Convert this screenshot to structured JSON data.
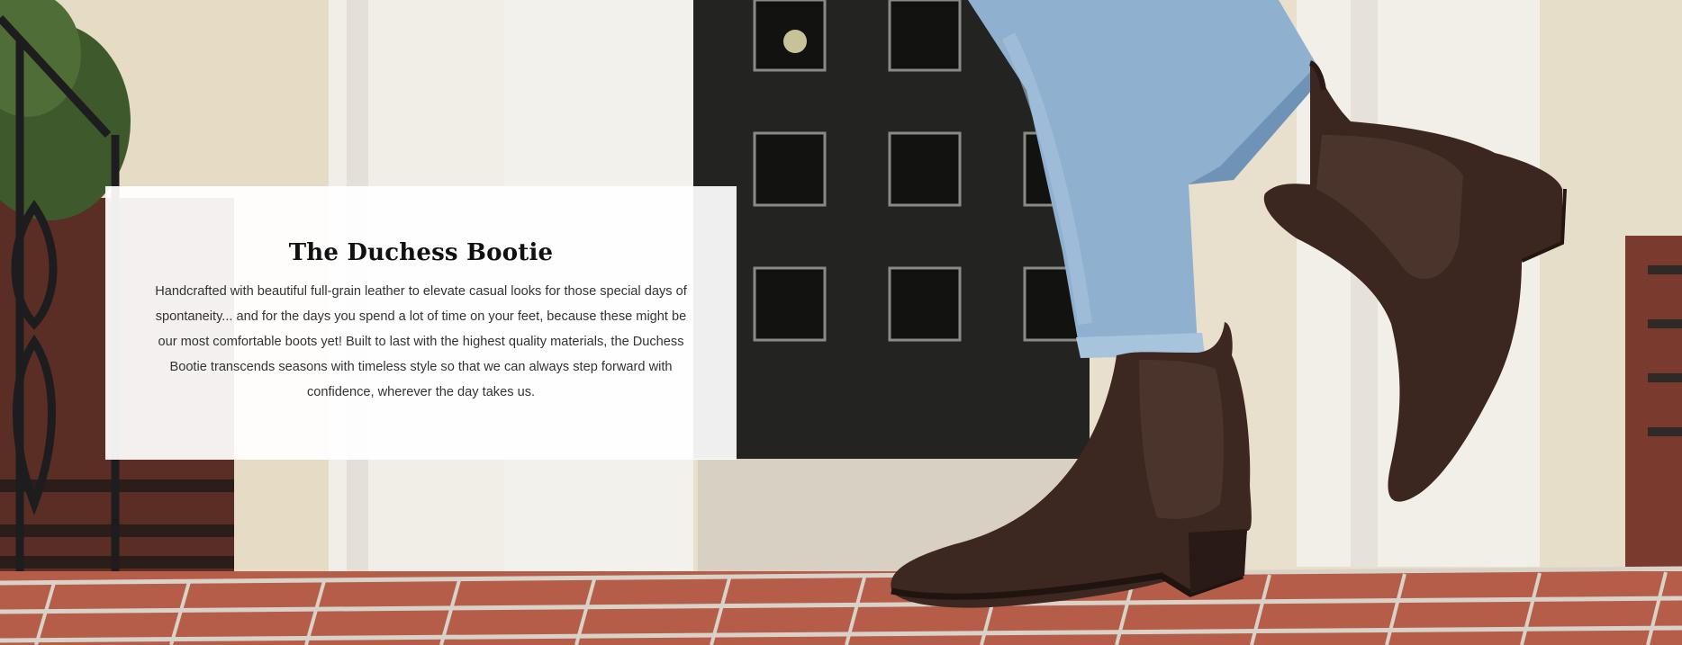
{
  "hero": {
    "title": "The Duchess Bootie",
    "description": "Handcrafted with beautiful full-grain leather to elevate casual looks for those special days of spontaneity... and for the days you spend a lot of time on your feet, because these might be our most comfortable boots yet! Built to last with the highest quality materials, the Duchess Bootie transcends seasons with timeless style so that we can always step forward with confidence, wherever the day takes us.",
    "colors": {
      "card_background": "#ffffff",
      "title": "#111111",
      "body_text": "#333333",
      "boot_leather": "#3b2620",
      "denim": "#8fb0cf",
      "brick": "#b65a45",
      "door": "#232321"
    }
  }
}
